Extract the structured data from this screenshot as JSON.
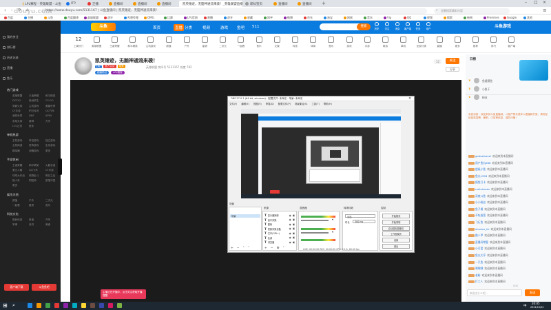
{
  "browser": {
    "tabs": [
      {
        "label": "LPL赛程 - 英雄联盟 - 斗鱼",
        "color": "#f39800"
      },
      {
        "label": "ITP",
        "color": "#1a73e8"
      },
      {
        "label": "正播",
        "color": "#e53935"
      },
      {
        "label": "直播间",
        "color": "#f39800"
      },
      {
        "label": "直播间",
        "color": "#f39800"
      },
      {
        "label": "直播间",
        "color": "#f39800"
      },
      {
        "label": "凯英锤迹，无脑神通流来袭！_英雄联盟直播",
        "color": "#f39800"
      },
      {
        "label": "新标签页",
        "color": "#999"
      },
      {
        "label": "直播间",
        "color": "#f39800"
      },
      {
        "label": "直播间",
        "color": "#f39800"
      }
    ],
    "active_tab": "凯英锤迹，无脑神通流来袭！_英雄联盟直播",
    "url": "https://www.douyu.com/5131167 | 斗鱼直播间 | 凯英锤迹，无脑神通流来袭！",
    "search_placeholder": "金鹏搜索精彩内容",
    "bookmarks": [
      "百度",
      "主播",
      "斗鱼",
      "百度翻译",
      "英雄联盟",
      "虎牙",
      "哔哩哔哩",
      "OMG",
      "比赛",
      "LPL官网",
      "直播",
      "虎牙",
      "收藏",
      "知乎",
      "微博",
      "京东",
      "淘宝",
      "网易",
      "音乐",
      "Vip",
      "QQ",
      "视频",
      "搜索",
      "新闻",
      "Premiere",
      "Google",
      "其他"
    ]
  },
  "douyu_header": {
    "logo": "斗鱼",
    "nav": [
      "首页",
      "直播",
      "分类",
      "视频",
      "游戏",
      "鱼吧",
      "511"
    ],
    "search_button": "搜索",
    "user_icons": [
      "历史",
      "关注",
      "消息",
      "客户端",
      "任务",
      "用户"
    ],
    "right_brand": "斗鱼游戏"
  },
  "categories": [
    {
      "label": "上周热门",
      "count": "12"
    },
    {
      "label": "英雄联盟"
    },
    {
      "label": "王者荣耀"
    },
    {
      "label": "和平精英"
    },
    {
      "label": "主机游戏"
    },
    {
      "label": "颜值"
    },
    {
      "label": "户外"
    },
    {
      "label": "星秀"
    },
    {
      "label": "二次元"
    },
    {
      "label": "一起看"
    },
    {
      "label": "音乐"
    },
    {
      "label": "文娱"
    },
    {
      "label": "科技"
    },
    {
      "label": "体育"
    },
    {
      "label": "鱼乐"
    },
    {
      "label": "游戏"
    },
    {
      "label": "手游"
    },
    {
      "label": "网游"
    },
    {
      "label": "单机"
    },
    {
      "label": "全部分类"
    },
    {
      "label": "直播"
    },
    {
      "label": "更多"
    },
    {
      "label": "推荐"
    },
    {
      "label": "排行"
    },
    {
      "label": "客户端"
    }
  ],
  "room": {
    "title": "凯英锤迹，无脑神通流来袭！",
    "badges": [
      "LPL",
      "官方认证",
      "电竞"
    ],
    "meta": "英雄联盟  房间号 5131167  热度 782",
    "tags": [
      "超级粉丝",
      "LPL赛程"
    ],
    "follow_label": "关注",
    "follow_count": "12",
    "share_label": "分享"
  },
  "obs": {
    "title": "OBS 27.0.1 (64 bit, windows) - 配置文件: 未命名 - 场景: 未命名",
    "menu": [
      "文件(F)",
      "编辑(E)",
      "视图(V)",
      "停靠(D)",
      "配置文件(P)",
      "场景集合(S)",
      "工具(T)",
      "帮助(H)"
    ],
    "panels": {
      "scenes": "场景",
      "sources": "来源",
      "mixer": "混音器",
      "transitions": "转场特效",
      "controls": "控制"
    },
    "sources_list": [
      "显示器捕获",
      "窗口采集",
      "图像",
      "视频采集设备",
      "文本(GDI+)",
      "色源",
      "浏览器"
    ],
    "control_buttons": [
      "开始推流",
      "开始录制",
      "启动虚拟摄像机",
      "工作室模式",
      "设置",
      "退出"
    ],
    "status": "LIVE: 00:00:00  REC: 00:00:00  CPU: 2.1%, 60.00 fps",
    "transition_value": "淡出",
    "duration_label": "时长",
    "duration_value": "300 ms"
  },
  "chat": {
    "ranking_title": "日榜",
    "top_fans": [
      "鱼塘摸鱼",
      "小鱼干",
      "粉丝"
    ],
    "announcement": "系统消息：欢迎来到斗鱼直播间，斗鱼严禁未成年人直播和打赏，请勿轻信各类招聘、兼职、中奖等信息，谨防诈骗！",
    "messages": [
      {
        "user": "godsatsanel",
        "text": "欢迎来到本直播间"
      },
      {
        "user": "用户鱼丸888",
        "text": "欢迎来到本直播间"
      },
      {
        "user": "超级小鱼",
        "text": "欢迎来到本直播间"
      },
      {
        "user": "鱼丸1998",
        "text": "欢迎来到本直播间"
      },
      {
        "user": "摸鱼打卡",
        "text": "欢迎来到本直播间"
      },
      {
        "user": "radioheadz",
        "text": "欢迎来到本直播间"
      },
      {
        "user": "深夜斗鱼",
        "text": "欢迎来到本直播间"
      },
      {
        "user": "小小粉丝",
        "text": "欢迎来到本直播间"
      },
      {
        "user": "鱼子酱",
        "text": "欢迎来到本直播间"
      },
      {
        "user": "不吃香菜",
        "text": "欢迎来到本直播间"
      },
      {
        "user": "飞行鱼",
        "text": "欢迎来到本直播间"
      },
      {
        "user": "doudou_kk",
        "text": "欢迎来到本直播间"
      },
      {
        "user": "路人甲",
        "text": "欢迎来到本直播间"
      },
      {
        "user": "直播间常客",
        "text": "欢迎来到本直播间"
      },
      {
        "user": "小可爱",
        "text": "欢迎来到本直播间"
      },
      {
        "user": "鱼丸大亨",
        "text": "欢迎来到本直播间"
      },
      {
        "user": "一只鱼",
        "text": "欢迎来到本直播间"
      },
      {
        "user": "嘿嘿嘿",
        "text": "欢迎来到本直播间"
      },
      {
        "user": "老粉",
        "text": "欢迎来到本直播间"
      },
      {
        "user": "打工人",
        "text": "欢迎来到本直播间"
      }
    ],
    "input_placeholder": "来说点什么吧~",
    "send_label": "发送",
    "send_counter": "0/40"
  },
  "sidebar": {
    "items": [
      "我的关注",
      "排行榜",
      "历史记录",
      "直播",
      "鱼乐"
    ],
    "sections": [
      {
        "title": "热门游戏",
        "entries": [
          "英雄联盟",
          "王者荣耀",
          "和平精英",
          "DOTA2",
          "绝地求生",
          "CS:GO",
          "穿越火线",
          "主机游戏",
          "魔兽世界",
          "CF手游",
          "炉石传说",
          "QQ飞车",
          "我的世界",
          "DNF",
          "APEX",
          "永劫无间",
          "原神",
          "方舟",
          "LOL云顶",
          "更多"
        ]
      },
      {
        "title": "单机热游",
        "entries": [
          "主机游戏",
          "怀旧游戏",
          "独立游戏",
          "主机网游",
          "恐怖游戏",
          "生存游戏",
          "模拟器",
          "战略游戏",
          "更多"
        ]
      },
      {
        "title": "手游休闲",
        "entries": [
          "王者荣耀",
          "和平精英",
          "火影忍者",
          "第五人格",
          "QQ飞车",
          "CF手游",
          "球球大作战",
          "荒野乱斗",
          "明日之后",
          "狼人杀",
          "阴阳师",
          "部落冲突",
          "更多"
        ]
      },
      {
        "title": "娱乐天地",
        "entries": [
          "颜值",
          "户外",
          "二次元",
          "一起看",
          "星秀",
          "音乐"
        ]
      },
      {
        "title": "科技文化",
        "entries": [
          "数码科技",
          "科普",
          "汽车",
          "军事",
          "读书",
          "美食"
        ]
      }
    ],
    "bottom_buttons": [
      "客户端下载",
      "斗鱼鱼吧"
    ]
  },
  "popup_note": "主播正在开播中，点击关注获取开播提醒",
  "taskbar": {
    "time": "20:05",
    "date": "2021/10/22",
    "ime": "中"
  },
  "watermark": "douyu.com",
  "colors": {
    "douyu_blue": "#0a7ce0",
    "douyu_orange": "#ff7700",
    "sidebar_bg": "#222222",
    "player_bg": "#1b1b1b",
    "taskbar_bg": "#1e2833"
  }
}
